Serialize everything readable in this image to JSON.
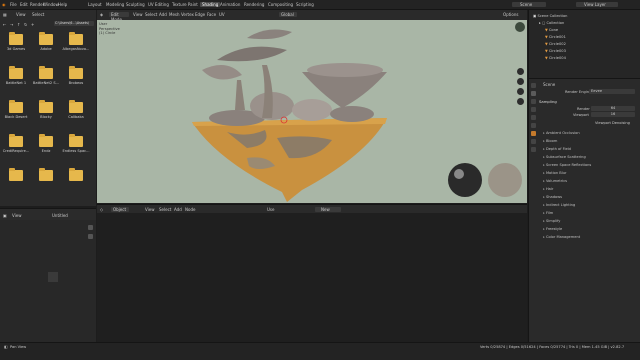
{
  "topbar": {
    "menus": [
      "File",
      "Edit",
      "Render",
      "Window",
      "Help"
    ],
    "workspaces": [
      "Layout",
      "Modeling",
      "Sculpting",
      "UV Editing",
      "Texture Paint",
      "Shading",
      "Animation",
      "Rendering",
      "Compositing",
      "Scripting"
    ],
    "active_workspace": "Shading",
    "scene_label": "Scene",
    "view_layer_label": "View Layer"
  },
  "filebrowser": {
    "menus": [
      "View",
      "Select"
    ],
    "path": "C:\\Users\\6...\\Assets\\",
    "folders": [
      {
        "label": "3d Games"
      },
      {
        "label": "Adobe"
      },
      {
        "label": "AlbegasNovo..."
      },
      {
        "label": "BattleNet 1"
      },
      {
        "label": "BattleNet2 S..."
      },
      {
        "label": "Brobeos"
      },
      {
        "label": "Black Desert"
      },
      {
        "label": "Blocky"
      },
      {
        "label": "Calibaka"
      },
      {
        "label": "CrediRequire..."
      },
      {
        "label": "Endz"
      },
      {
        "label": "Endless Spac..."
      },
      {
        "label": ""
      },
      {
        "label": ""
      },
      {
        "label": ""
      }
    ]
  },
  "imagebrowser": {
    "view": "View",
    "title": "Untitled"
  },
  "viewport": {
    "mode": "Edit Mode",
    "menus": [
      "View",
      "Select",
      "Add",
      "Mesh",
      "Vertex",
      "Edge",
      "Face",
      "UV"
    ],
    "orientation": "Global",
    "options": "Options",
    "overlay_title": "User Perspective",
    "overlay_sub": "(1) Circle"
  },
  "nodeeditor": {
    "type": "Object",
    "menus": [
      "View",
      "Select",
      "Add",
      "Node"
    ],
    "slot": "Use",
    "material_field": "New"
  },
  "outliner": {
    "title": "Scene Collection",
    "items": [
      "Collection",
      "Cone",
      "Circle001",
      "Circle002",
      "Circle003",
      "Circle004"
    ]
  },
  "properties": {
    "scene_label": "Scene",
    "render_engine_label": "Render Engine",
    "render_engine": "Eevee",
    "sampling_label": "Sampling",
    "render_label": "Render",
    "render_value": "64",
    "viewport_label": "Viewport",
    "viewport_value": "16",
    "denoise_label": "Viewport Denoising",
    "sections": [
      "Ambient Occlusion",
      "Bloom",
      "Depth of Field",
      "Subsurface Scattering",
      "Screen Space Reflections",
      "Motion Blur",
      "Volumetrics",
      "Hair",
      "Shadows",
      "Indirect Lighting",
      "Film",
      "Simplify",
      "Freestyle",
      "Color Management"
    ]
  },
  "statusbar": {
    "left": "Pan View",
    "right": "Verts 0/25874 | Edges 0/51624 | Faces 0/25774 | Tris 0 | Mem 1.45 GiB | v2.82.7"
  },
  "colors": {
    "viewport_bg": "#a9b6a6",
    "folder": "#e6b84c",
    "island_top": "#c9913f",
    "rock": "#8a817c",
    "active_tab": "#4a4a4a"
  }
}
